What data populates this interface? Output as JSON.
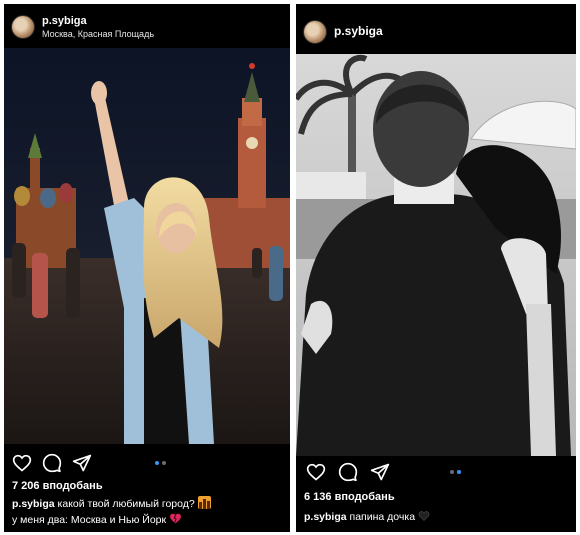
{
  "left_post": {
    "username": "p.sybiga",
    "location": "Москва, Красная Площадь",
    "likes": "7 206 вподобань",
    "caption_user": "p.sybiga",
    "caption_line1": "какой твой любимый город?",
    "caption_line2": "у меня два: Москва и Нью Йорк",
    "emoji1": "city-sunset-emoji",
    "emoji2": "broken-heart-emoji",
    "carousel": {
      "count": 2,
      "active": 1
    }
  },
  "right_post": {
    "username": "p.sybiga",
    "likes": "6 136 вподобань",
    "caption_user": "p.sybiga",
    "caption_text": "папина дочка",
    "emoji": "black-heart-emoji",
    "carousel": {
      "count": 2,
      "active": 2
    }
  },
  "colors": {
    "background": "#000000",
    "carousel_active": "#3897f0",
    "carousel_inactive": "#6b6b6b"
  }
}
